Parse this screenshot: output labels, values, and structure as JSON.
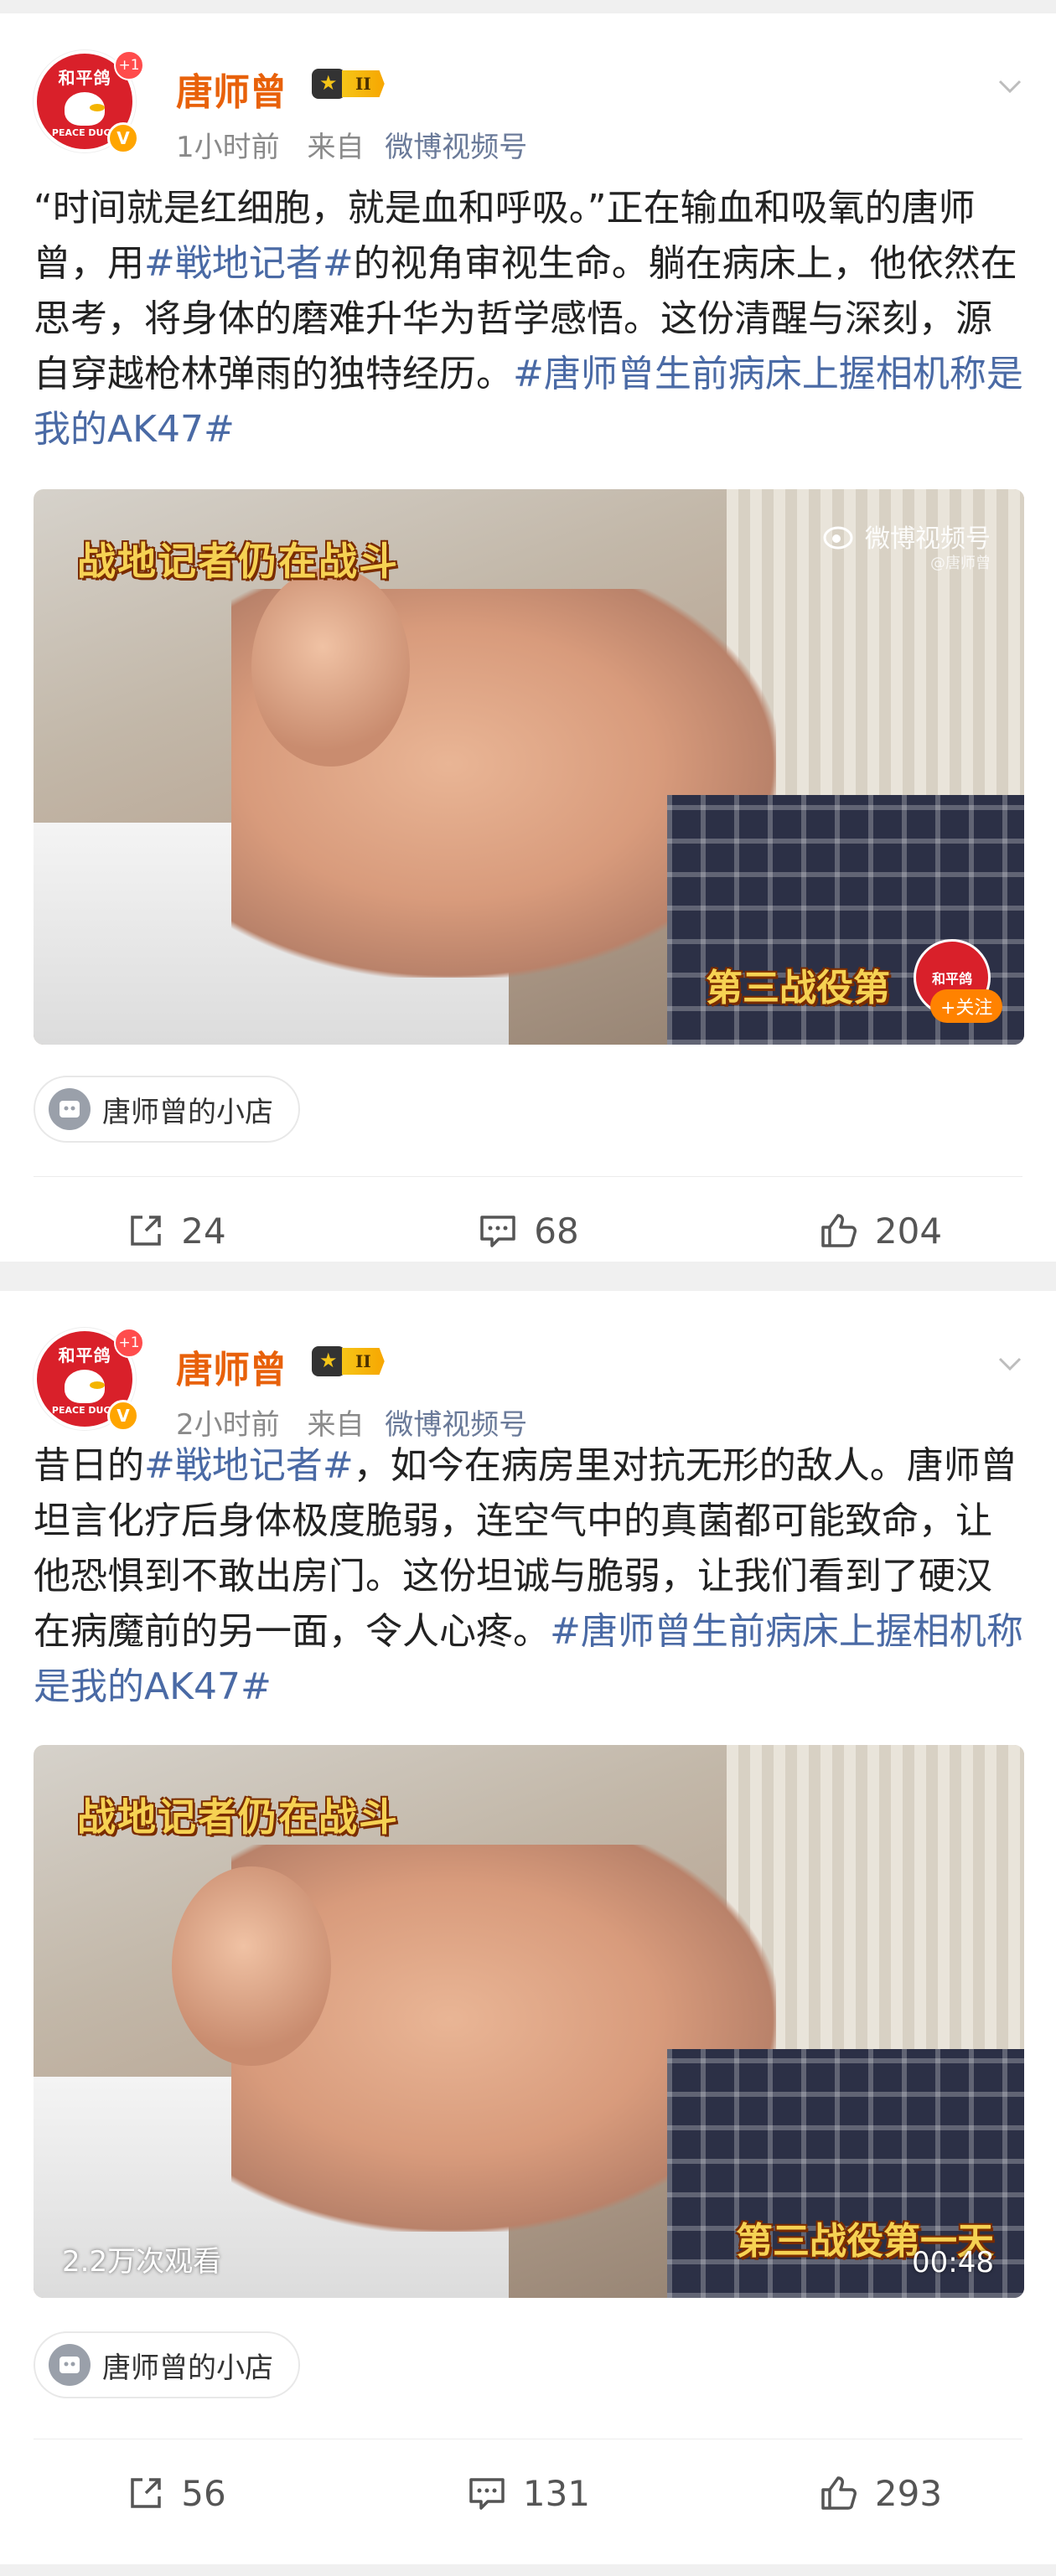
{
  "posts": [
    {
      "author": {
        "name": "唐师曾",
        "vip_level": "II",
        "avatar_text_top": "和平鸽",
        "avatar_text_bottom": "PEACE DUCK",
        "avatar_badge": "+1",
        "verified_mark": "V"
      },
      "time": "1小时前",
      "source_prefix": "来自",
      "source": "微博视频号",
      "text": [
        {
          "t": "“时间就是红细胞，就是血和呼吸。”正在输血和吸氧的唐师曾，用"
        },
        {
          "t": "#戦地记者#",
          "tag": true
        },
        {
          "t": "的视角审视生命。躺在病床上，他依然在思考，将身体的磨难升华为哲学感悟。这份清醒与深刻，源自穿越枪林弹雨的独特经历。"
        },
        {
          "t": "#唐师曾生前病床上握相机称是我的AK47#",
          "tag": true
        }
      ],
      "video": {
        "overlay_title": "战地记者仍在战斗",
        "overlay_sub": "第三战役第",
        "watermark": "微博视频号",
        "watermark_sub": "@唐师曾",
        "follow_logo": "和平鸽",
        "follow_label": "+关注"
      },
      "shop": "唐师曾的小店",
      "actions": {
        "repost": "24",
        "comment": "68",
        "like": "204"
      }
    },
    {
      "author": {
        "name": "唐师曾",
        "vip_level": "II",
        "avatar_text_top": "和平鸽",
        "avatar_text_bottom": "PEACE DUCK",
        "avatar_badge": "+1",
        "verified_mark": "V"
      },
      "time": "2小时前",
      "source_prefix": "来自",
      "source": "微博视频号",
      "text": [
        {
          "t": "昔日的"
        },
        {
          "t": "#戦地记者#",
          "tag": true
        },
        {
          "t": "，如今在病房里对抗无形的敌人。唐师曾坦言化疗后身体极度脆弱，连空气中的真菌都可能致命，让他恐惧到不敢出房门。这份坦诚与脆弱，让我们看到了硬汉在病魔前的另一面，令人心疼。"
        },
        {
          "t": "#唐师曾生前病床上握相机称是我的AK47#",
          "tag": true
        }
      ],
      "video": {
        "overlay_title": "战地记者仍在战斗",
        "overlay_sub": "第三战役第一天",
        "view_count": "2.2万次观看",
        "duration": "00:48"
      },
      "shop": "唐师曾的小店",
      "actions": {
        "repost": "56",
        "comment": "131",
        "like": "293"
      }
    }
  ],
  "colors": {
    "author_name": "#e8610a",
    "hashtag": "#4a6aa5",
    "overlay_text": "#f6d253",
    "follow_button": "#ff8200",
    "page_bg": "#f0f0f0"
  }
}
